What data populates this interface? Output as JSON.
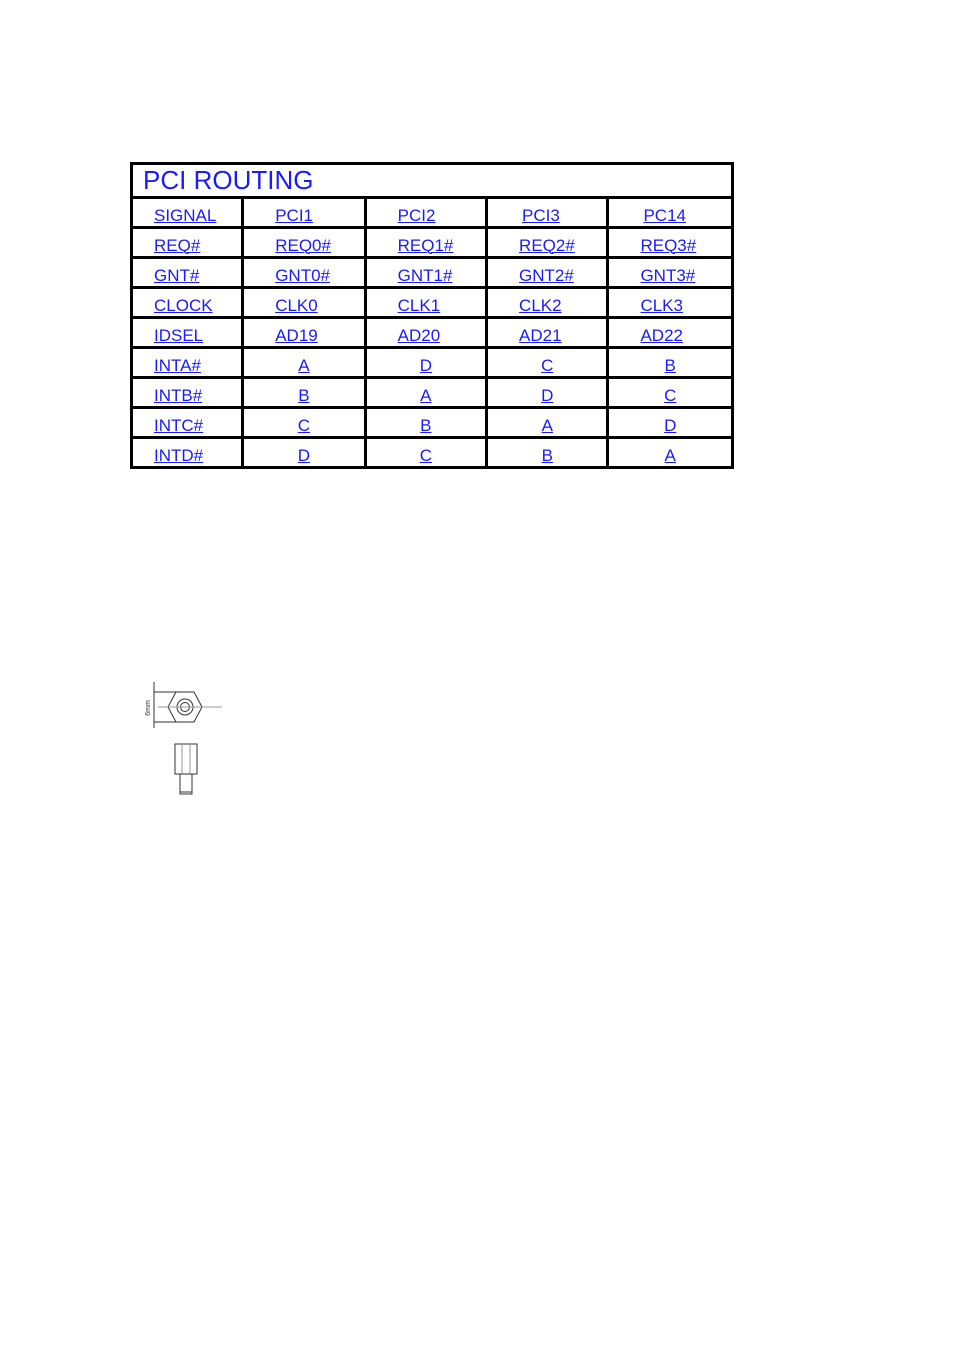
{
  "table": {
    "title": "PCI ROUTING",
    "header": [
      "SIGNAL",
      "PCI1",
      "PCI2",
      "PCI3",
      "PC14"
    ],
    "rows": [
      [
        "REQ#",
        "REQ0#",
        "REQ1#",
        "REQ2#",
        "REQ3#"
      ],
      [
        "GNT#",
        "GNT0#",
        "GNT1#",
        "GNT2#",
        "GNT3#"
      ],
      [
        "CLOCK",
        "CLK0",
        "CLK1",
        "CLK2",
        "CLK3"
      ],
      [
        "IDSEL",
        "AD19",
        "AD20",
        "AD21",
        "AD22"
      ],
      [
        "INTA#",
        "A",
        "D",
        "C",
        "B"
      ],
      [
        "INTB#",
        "B",
        "A",
        "D",
        "C"
      ],
      [
        "INTC#",
        "C",
        "B",
        "A",
        "D"
      ],
      [
        "INTD#",
        "D",
        "C",
        "B",
        "A"
      ]
    ]
  },
  "standoff_drawing": {
    "dimension_label": "6mm"
  },
  "colors": {
    "text": "#1a1aff",
    "border": "#000000"
  }
}
